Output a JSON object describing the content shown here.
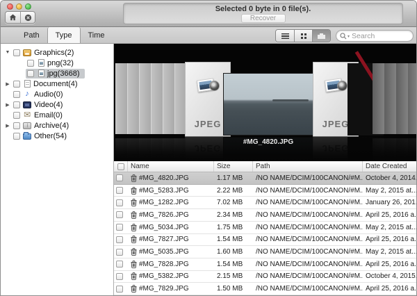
{
  "toolbar": {
    "status_text": "Selected 0 byte in 0 file(s).",
    "recover_label": "Recover"
  },
  "tabs": [
    {
      "label": "Path",
      "active": false
    },
    {
      "label": "Type",
      "active": true
    },
    {
      "label": "Time",
      "active": false
    }
  ],
  "view_toggle": [
    {
      "name": "list-view",
      "active": false
    },
    {
      "name": "grid-view",
      "active": false
    },
    {
      "name": "coverflow-view",
      "active": true
    }
  ],
  "search": {
    "placeholder": "Search"
  },
  "icons": {
    "disclosure_expanded": "▼",
    "disclosure_collapsed": "▶",
    "audio_glyph": "♪",
    "email_glyph": "✉",
    "search_chevron": "▾"
  },
  "sidebar": {
    "items": [
      {
        "label": "Graphics(2)",
        "icon": "image",
        "disclosure": "expanded",
        "level": 0,
        "selected": false
      },
      {
        "label": "png(32)",
        "icon": "file-image",
        "disclosure": "none",
        "level": 1,
        "selected": false
      },
      {
        "label": "jpg(3668)",
        "icon": "file-image",
        "disclosure": "none",
        "level": 1,
        "selected": true
      },
      {
        "label": "Document(4)",
        "icon": "document",
        "disclosure": "collapsed",
        "level": 0,
        "selected": false
      },
      {
        "label": "Audio(0)",
        "icon": "audio",
        "disclosure": "none",
        "level": 0,
        "selected": false
      },
      {
        "label": "Video(4)",
        "icon": "video",
        "disclosure": "collapsed",
        "level": 0,
        "selected": false
      },
      {
        "label": "Email(0)",
        "icon": "email",
        "disclosure": "none",
        "level": 0,
        "selected": false
      },
      {
        "label": "Archive(4)",
        "icon": "archive",
        "disclosure": "collapsed",
        "level": 0,
        "selected": false
      },
      {
        "label": "Other(54)",
        "icon": "folder",
        "disclosure": "none",
        "level": 0,
        "selected": false
      }
    ]
  },
  "coverflow": {
    "caption": "#MG_4820.JPG",
    "card_label": "JPEG"
  },
  "table": {
    "columns": [
      "Name",
      "Size",
      "Path",
      "Date Created"
    ],
    "rows": [
      {
        "name": "#MG_4820.JPG",
        "size": "1.17 MB",
        "path": "/NO NAME/DCIM/100CANON/#M...",
        "date": "October 4, 2014...",
        "selected": true
      },
      {
        "name": "#MG_5283.JPG",
        "size": "2.22 MB",
        "path": "/NO NAME/DCIM/100CANON/#M...",
        "date": "May 2, 2015 at...",
        "selected": false
      },
      {
        "name": "#MG_1282.JPG",
        "size": "7.02 MB",
        "path": "/NO NAME/DCIM/100CANON/#M...",
        "date": "January 26, 201...",
        "selected": false
      },
      {
        "name": "#MG_7826.JPG",
        "size": "2.34 MB",
        "path": "/NO NAME/DCIM/100CANON/#M...",
        "date": "April 25, 2016 a...",
        "selected": false
      },
      {
        "name": "#MG_5034.JPG",
        "size": "1.75 MB",
        "path": "/NO NAME/DCIM/100CANON/#M...",
        "date": "May 2, 2015 at...",
        "selected": false
      },
      {
        "name": "#MG_7827.JPG",
        "size": "1.54 MB",
        "path": "/NO NAME/DCIM/100CANON/#M...",
        "date": "April 25, 2016 a...",
        "selected": false
      },
      {
        "name": "#MG_5035.JPG",
        "size": "1.60 MB",
        "path": "/NO NAME/DCIM/100CANON/#M...",
        "date": "May 2, 2015 at...",
        "selected": false
      },
      {
        "name": "#MG_7828.JPG",
        "size": "1.54 MB",
        "path": "/NO NAME/DCIM/100CANON/#M...",
        "date": "April 25, 2016 a...",
        "selected": false
      },
      {
        "name": "#MG_5382.JPG",
        "size": "2.15 MB",
        "path": "/NO NAME/DCIM/100CANON/#M...",
        "date": "October 4, 2015...",
        "selected": false
      },
      {
        "name": "#MG_7829.JPG",
        "size": "1.50 MB",
        "path": "/NO NAME/DCIM/100CANON/#M...",
        "date": "April 25, 2016 a...",
        "selected": false
      }
    ]
  }
}
